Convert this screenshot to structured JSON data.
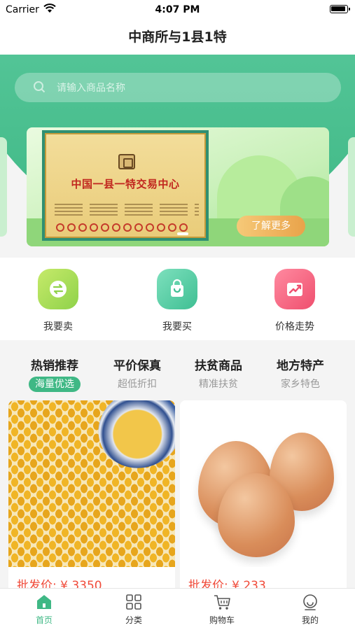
{
  "status_bar": {
    "carrier": "Carrier",
    "time": "4:07 PM"
  },
  "nav": {
    "title": "中商所与1县1特"
  },
  "search": {
    "placeholder": "请输入商品名称"
  },
  "banner": {
    "certificate_title": "中国一县一特交易中心",
    "more_button": "了解更多"
  },
  "shortcuts": [
    {
      "label": "我要卖",
      "icon": "exchange-icon"
    },
    {
      "label": "我要买",
      "icon": "shopping-bag-icon"
    },
    {
      "label": "价格走势",
      "icon": "trend-chart-icon"
    }
  ],
  "tabs": [
    {
      "title": "热销推荐",
      "subtitle": "海量优选",
      "active": true
    },
    {
      "title": "平价保真",
      "subtitle": "超低折扣",
      "active": false
    },
    {
      "title": "扶贫商品",
      "subtitle": "精准扶贫",
      "active": false
    },
    {
      "title": "地方特产",
      "subtitle": "家乡特色",
      "active": false
    }
  ],
  "products": [
    {
      "image": "corn-kernels",
      "price": "批发价: ¥ 3350"
    },
    {
      "image": "brown-eggs",
      "price": "批发价: ¥ 233"
    }
  ],
  "tabbar": [
    {
      "label": "首页",
      "icon": "home-icon",
      "active": true
    },
    {
      "label": "分类",
      "icon": "category-grid-icon",
      "active": false
    },
    {
      "label": "购物车",
      "icon": "cart-icon",
      "active": false
    },
    {
      "label": "我的",
      "icon": "profile-icon",
      "active": false
    }
  ],
  "colors": {
    "brand_green": "#3fb885",
    "price_red": "#f04b3a",
    "accent_orange": "#e9a34a"
  }
}
